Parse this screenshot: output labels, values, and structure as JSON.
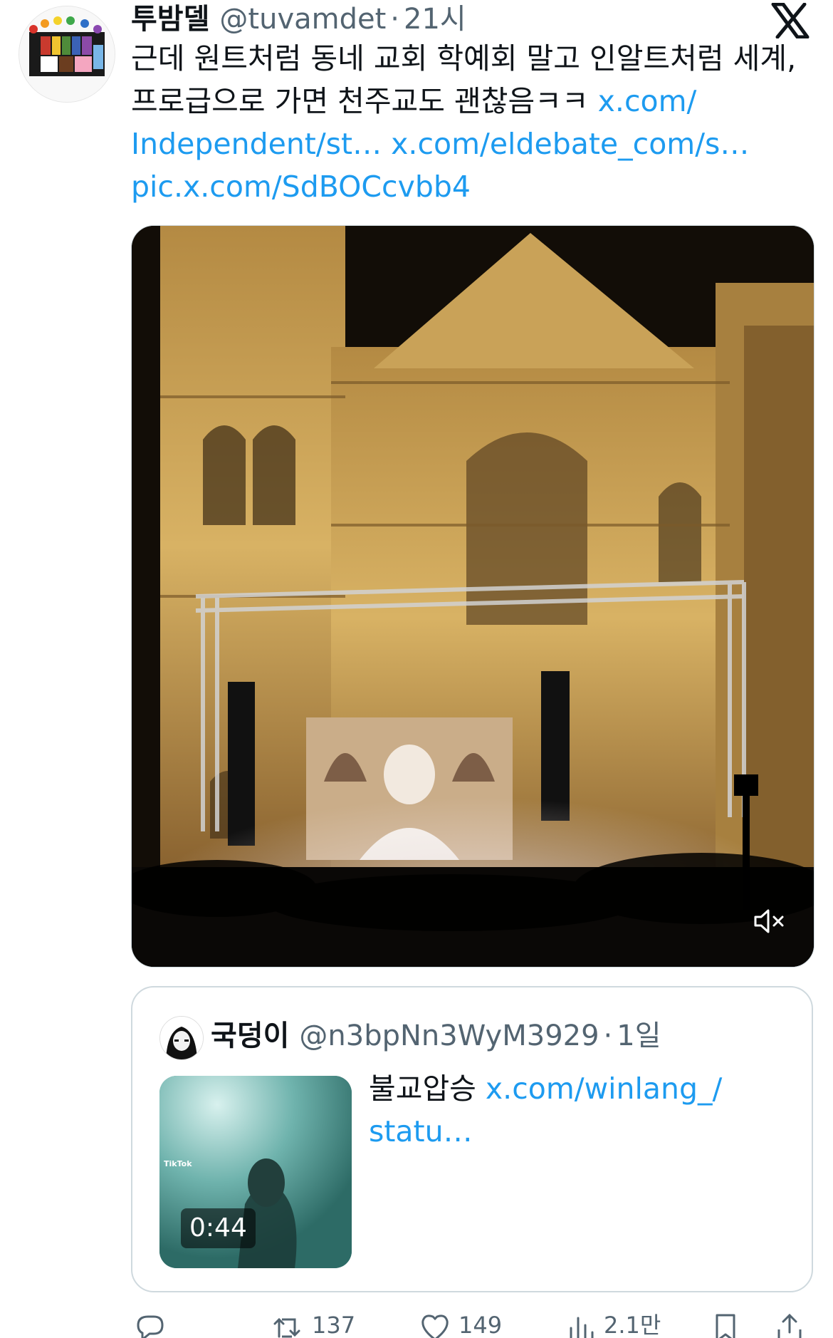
{
  "tweet": {
    "display_name": "투밤델",
    "handle": "@tuvamdet",
    "separator": "·",
    "time": "21시",
    "text_lines": [
      {
        "plain": "근데 원트처럼 동네 교회 학예회 말고 인알트처럼 세계,",
        "link": ""
      },
      {
        "plain": "프로급으로 가면 천주교도 괜찮음ㅋㅋ ",
        "link": "x.com/"
      },
      {
        "plain": "",
        "link": "Independent/st… x.com/eldebate_com/s…"
      },
      {
        "plain": "",
        "link": "pic.x.com/SdBOCcvbb4"
      }
    ],
    "mute_icon": "speaker-muted-icon",
    "platform_icon": "x-logo-icon"
  },
  "quote": {
    "display_name": "국덩이",
    "handle": "@n3bpNn3WyM3929",
    "separator": "·",
    "time": "1일",
    "text_plain": "불교압승 ",
    "text_link_1": "x.com/winlang_/",
    "text_link_2": "statu…",
    "video_duration": "0:44",
    "tiktok_label": "TikTok"
  },
  "actions": {
    "reply": {
      "icon": "reply-icon",
      "count": ""
    },
    "retweet": {
      "icon": "retweet-icon",
      "count": "137"
    },
    "like": {
      "icon": "heart-icon",
      "count": "149"
    },
    "views": {
      "icon": "views-icon",
      "count": "2.1만"
    },
    "bookmark": {
      "icon": "bookmark-icon",
      "count": ""
    },
    "share": {
      "icon": "share-icon",
      "count": ""
    }
  },
  "colors": {
    "link": "#1d9bf0",
    "muted_text": "#536471",
    "text": "#0f1419",
    "border": "#cfd9de"
  }
}
